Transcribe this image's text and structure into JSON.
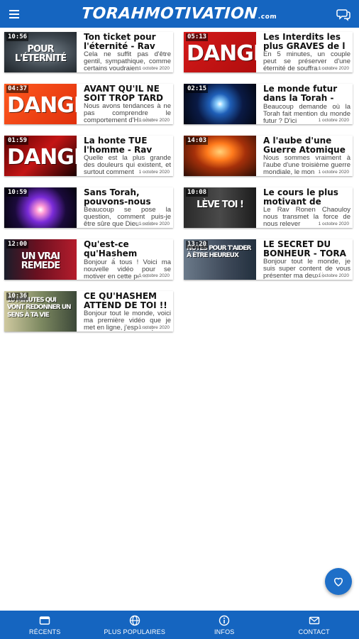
{
  "header": {
    "logo_main": "TORAHMOTIVATION",
    "logo_suffix": ".com"
  },
  "videos": [
    {
      "duration": "10:56",
      "title": "Ton ticket pour l'éternité - Rav",
      "description": "Cela ne suffit pas d'être gentil, sympathique, comme certains voudraient",
      "date": "1 octobre 2020",
      "thumb_text": "POUR L'ÉTERNITÉ",
      "thumb_style": "eternity"
    },
    {
      "duration": "05:13",
      "title": "Les Interdits les plus GRAVES de l",
      "description": "En 5 minutes, un couple peut se préserver d'une éternité de souffrances",
      "date": "1 octobre 2020",
      "thumb_text": "DANGER",
      "thumb_style": "danger-red"
    },
    {
      "duration": "04:37",
      "title": "AVANT QU'IL NE SOIT TROP TARD",
      "description": "Nous avons tendances à ne pas comprendre le comportement d'Hashe",
      "date": "1 octobre 2020",
      "thumb_text": "DANGER",
      "thumb_style": "danger-orange"
    },
    {
      "duration": "02:15",
      "title": "Le monde futur dans la Torah - Rav",
      "description": "Beaucoup demande où la Torah fait mention du monde futur ? D'ici",
      "date": "1 octobre 2020",
      "thumb_text": "",
      "thumb_style": "galaxy"
    },
    {
      "duration": "01:59",
      "title": "La honte TUE l'homme - Rav",
      "description": "Quelle est la plus grande des douleurs qui existent, et surtout comment",
      "date": "1 octobre 2020",
      "thumb_text": "DANGER",
      "thumb_style": "danger-glitch"
    },
    {
      "duration": "14:03",
      "title": "A l'aube d'une Guerre Atomique",
      "description": "Nous sommes vraiment à l'aube d'une troisième guerre mondiale, le mon",
      "date": "1 octobre 2020",
      "thumb_text": "",
      "thumb_style": "nuke"
    },
    {
      "duration": "10:59",
      "title": "Sans Torah, pouvons-nous",
      "description": "Beaucoup se pose la question, comment puis-je être sûre que Dieu exis",
      "date": "1 octobre 2020",
      "thumb_text": "",
      "thumb_style": "flare"
    },
    {
      "duration": "10:08",
      "title": "Le cours le plus motivant de",
      "description": "Le Rav Ronen Chaouloy nous transmet la force de nous relever",
      "date": "1 octobre 2020",
      "thumb_text": "LÈVE TOI !",
      "thumb_style": "leve-toi"
    },
    {
      "duration": "12:00",
      "title": "Qu'est-ce qu'Hashem attend",
      "description": "Bonjour à tous ! Voici ma nouvelle vidéo pour se motiver en cette pério",
      "date": "1 octobre 2020",
      "thumb_text": "UN VRAI REMEDE",
      "thumb_style": "remede"
    },
    {
      "duration": "13:20",
      "title": "LE SECRET DU BONHEUR - TORA",
      "description": "Bonjour tout le monde, je suis super content de vous présenter ma deuxiè",
      "date": "1 octobre 2020",
      "thumb_text": "NOTES POUR T'AIDER À ÊTRE HEUREUX",
      "thumb_style": "bonheur"
    },
    {
      "duration": "10:36",
      "title": "CE QU'HASHEM ATTEND DE TOI !!",
      "description": "Bonjour tout le monde, voici ma première vidéo que je met en ligne, j'espère q",
      "date": "1 octobre 2020",
      "thumb_text": "10 MINUTES QUI VONT REDONNER UN SENS À TA VIE",
      "thumb_style": "sens"
    }
  ],
  "bottom_nav": [
    {
      "label": "RÉCENTS",
      "icon": "film-icon"
    },
    {
      "label": "PLUS POPULAIRES",
      "icon": "globe-icon"
    },
    {
      "label": "INFOS",
      "icon": "info-icon"
    },
    {
      "label": "CONTACT",
      "icon": "mail-icon"
    }
  ],
  "colors": {
    "primary": "#1565c0",
    "fab": "#1e6fc8"
  }
}
